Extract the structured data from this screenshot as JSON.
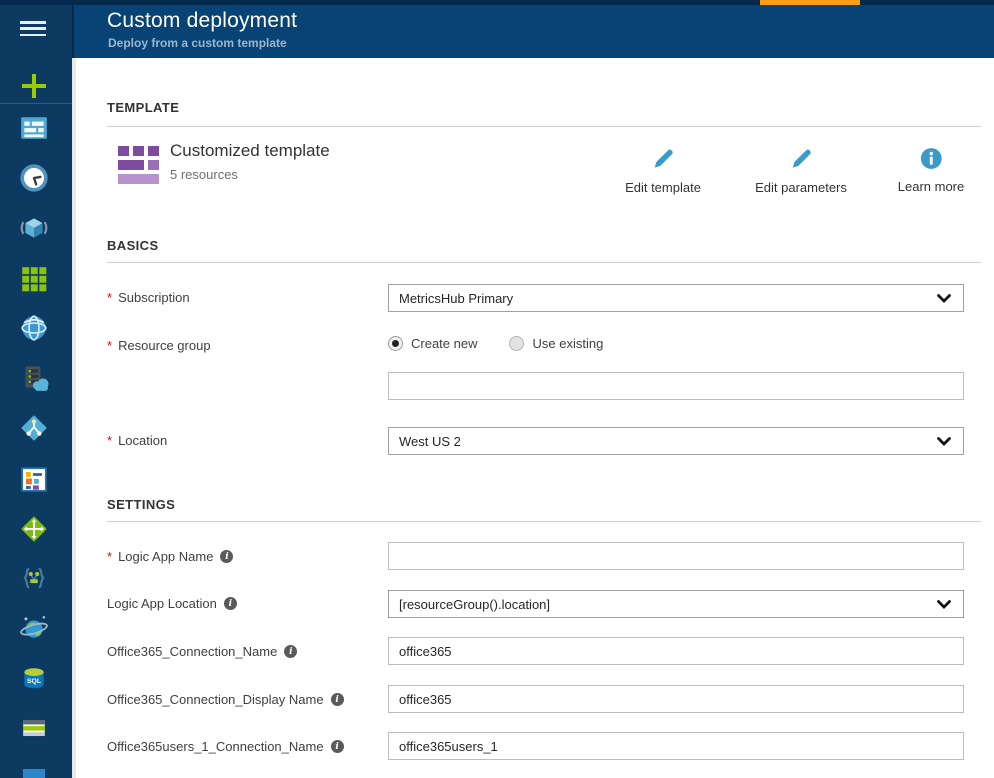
{
  "colors": {
    "accent_orange": "#fb9e13",
    "action_blue": "#3a9bc8",
    "required_red": "#e00b09",
    "header_navy": "#074374",
    "sidebar_navy": "#0d3a61"
  },
  "topbar": {
    "title": "Custom deployment",
    "subtitle": "Deploy from a custom template"
  },
  "sidebar": {
    "icons": [
      "hamburger-menu",
      "new-plus",
      "dashboard",
      "recent-clock",
      "resource-groups-cube",
      "all-resources-grid",
      "app-services-globe",
      "virtual-machines-server",
      "network-gateway-diamond",
      "monitor-metrics",
      "virtual-network-diamond",
      "logic-apps-braces",
      "cosmos-db-planet",
      "sql-database",
      "storage-stripes",
      "partial-icon"
    ]
  },
  "template": {
    "heading": "TEMPLATE",
    "card_title": "Customized template",
    "card_subtitle": "5 resources",
    "actions": [
      {
        "label": "Edit template",
        "icon": "pencil-icon"
      },
      {
        "label": "Edit parameters",
        "icon": "pencil-icon"
      },
      {
        "label": "Learn more",
        "icon": "info-icon"
      }
    ]
  },
  "basics": {
    "heading": "BASICS",
    "required_marker": "*",
    "subscription": {
      "label": "Subscription",
      "value": "MetricsHub Primary"
    },
    "resource_group": {
      "label": "Resource group",
      "options": [
        "Create new",
        "Use existing"
      ],
      "selected": "Create new",
      "new_name_value": ""
    },
    "location": {
      "label": "Location",
      "value": "West US 2"
    }
  },
  "settings": {
    "heading": "SETTINGS",
    "required_marker": "*",
    "rows": [
      {
        "label": "Logic App Name",
        "required": true,
        "type": "text",
        "value": ""
      },
      {
        "label": "Logic App Location",
        "required": false,
        "type": "select",
        "value": "[resourceGroup().location]"
      },
      {
        "label": "Office365_Connection_Name",
        "required": false,
        "type": "text",
        "value": "office365"
      },
      {
        "label": "Office365_Connection_Display Name",
        "required": false,
        "type": "text",
        "value": "office365"
      },
      {
        "label": "Office365users_1_Connection_Name",
        "required": false,
        "type": "text",
        "value": "office365users_1"
      }
    ]
  }
}
